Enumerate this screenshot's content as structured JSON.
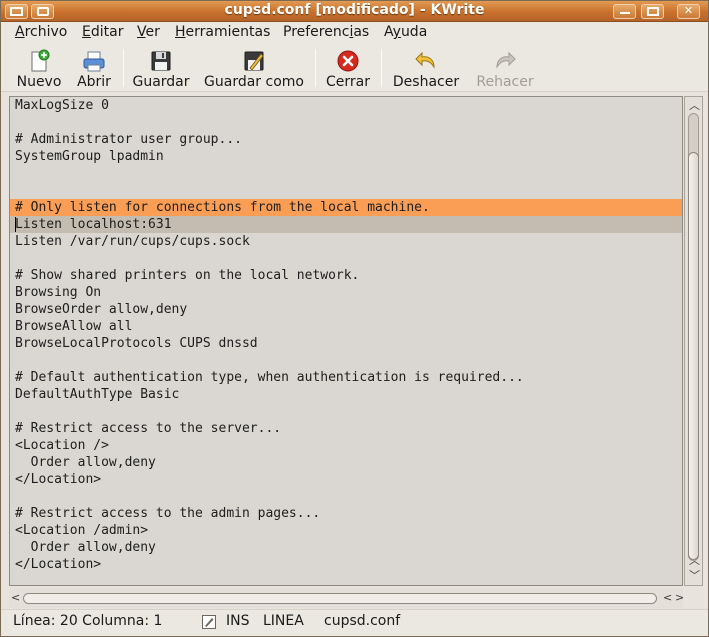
{
  "window": {
    "title": "cupsd.conf [modificado] - KWrite"
  },
  "menu": {
    "items": [
      {
        "pre": "",
        "ul": "A",
        "post": "rchivo"
      },
      {
        "pre": "",
        "ul": "E",
        "post": "ditar"
      },
      {
        "pre": "",
        "ul": "V",
        "post": "er"
      },
      {
        "pre": "",
        "ul": "H",
        "post": "erramientas"
      },
      {
        "pre": "Preferenc",
        "ul": "i",
        "post": "as"
      },
      {
        "pre": "A",
        "ul": "y",
        "post": "uda"
      }
    ]
  },
  "toolbar": {
    "new_label": "Nuevo",
    "open_label": "Abrir",
    "save_label": "Guardar",
    "save_as_label": "Guardar como",
    "close_label": "Cerrar",
    "undo_label": "Deshacer",
    "redo_label": "Rehacer"
  },
  "editor": {
    "lines": [
      "MaxLogSize 0",
      "",
      "# Administrator user group...",
      "SystemGroup lpadmin",
      "",
      "",
      "# Only listen for connections from the local machine.",
      "Listen localhost:631",
      "Listen /var/run/cups/cups.sock",
      "",
      "# Show shared printers on the local network.",
      "Browsing On",
      "BrowseOrder allow,deny",
      "BrowseAllow all",
      "BrowseLocalProtocols CUPS dnssd",
      "",
      "# Default authentication type, when authentication is required...",
      "DefaultAuthType Basic",
      "",
      "# Restrict access to the server...",
      "<Location />",
      "  Order allow,deny",
      "</Location>",
      "",
      "# Restrict access to the admin pages...",
      "<Location /admin>",
      "  Order allow,deny",
      "</Location>"
    ],
    "highlight_color": "#fb9e55",
    "current_line_color": "#c4bcb0"
  },
  "status": {
    "position": "Línea: 20 Columna: 1",
    "insert_mode": "INS",
    "selection_mode": "LINEA",
    "filename": "cupsd.conf"
  },
  "icons": {
    "new": "new-document-icon",
    "open": "printer-open-icon",
    "save": "floppy-disk-icon",
    "save_as": "floppy-edit-icon",
    "close": "red-close-icon",
    "undo": "undo-arrow-icon",
    "redo": "redo-arrow-icon"
  }
}
